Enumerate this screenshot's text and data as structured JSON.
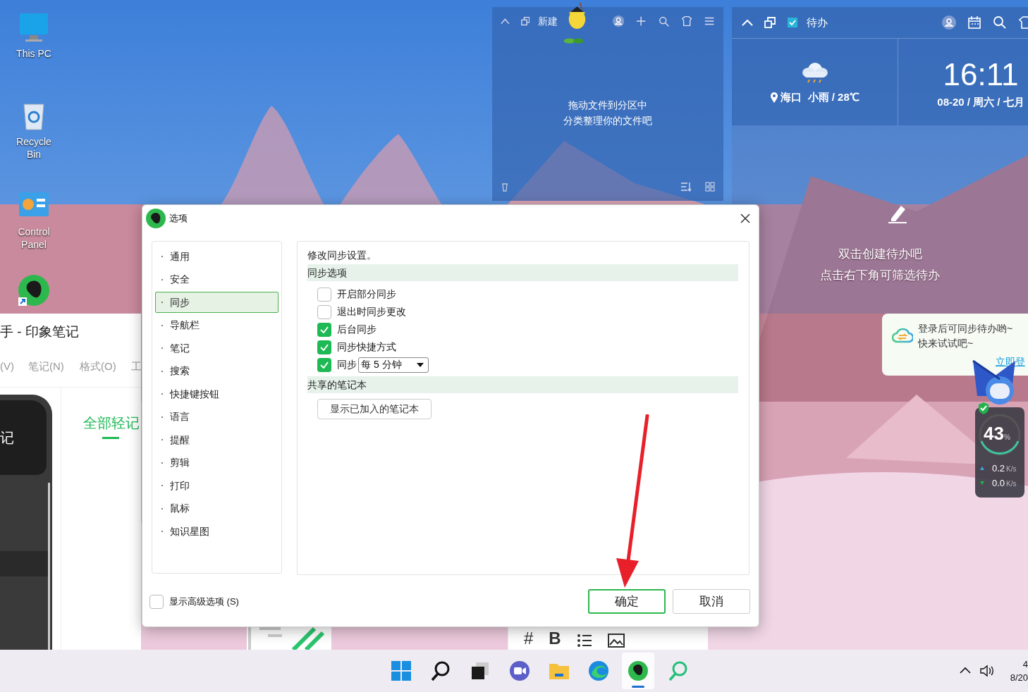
{
  "desktop_icons": [
    {
      "label": "This PC",
      "kind": "pc"
    },
    {
      "label": "Recycle Bin",
      "kind": "bin"
    },
    {
      "label": "Control Panel",
      "kind": "control"
    },
    {
      "kind": "evernote"
    }
  ],
  "files_widget": {
    "title": "新建",
    "message": [
      "拖动文件到分区中",
      "分类整理你的文件吧"
    ]
  },
  "todo_widget": {
    "title": "待办",
    "weather": "海口  小雨 / 28℃",
    "time": "16:11",
    "date": "08-20 / 周六 / 七月",
    "hint": [
      "双击创建待办吧",
      "点击右下角可筛选待办"
    ]
  },
  "login_popup": {
    "message": [
      "登录后可同步待办哟~",
      "快来试试吧~"
    ],
    "link": "立即登"
  },
  "net_monitor": {
    "percent": "43",
    "unit": "%",
    "up": "0.2",
    "up_unit": "K/s",
    "down": "0.0",
    "down_unit": "K/s"
  },
  "background_app": {
    "title": "手 - 印象笔记",
    "menu": [
      "(V)",
      "笔记(N)",
      "格式(O)",
      "工"
    ],
    "sidebar_text": "记",
    "tab": "全部轻记"
  },
  "editor_toolbar": [
    "#",
    "B"
  ],
  "dialog": {
    "title": "选项",
    "nav": [
      {
        "label": "通用",
        "selected": false
      },
      {
        "label": "安全",
        "selected": false
      },
      {
        "label": "同步",
        "selected": true
      },
      {
        "label": "导航栏",
        "selected": false
      },
      {
        "label": "笔记",
        "selected": false
      },
      {
        "label": "搜索",
        "selected": false
      },
      {
        "label": "快捷键按钮",
        "selected": false
      },
      {
        "label": "语言",
        "selected": false
      },
      {
        "label": "提醒",
        "selected": false
      },
      {
        "label": "剪辑",
        "selected": false
      },
      {
        "label": "打印",
        "selected": false
      },
      {
        "label": "鼠标",
        "selected": false
      },
      {
        "label": "知识星图",
        "selected": false
      }
    ],
    "heading": "修改同步设置。",
    "sections": [
      {
        "title": "同步选项",
        "options": [
          {
            "kind": "checkbox",
            "label": "开启部分同步",
            "checked": false
          },
          {
            "kind": "checkbox",
            "label": "退出时同步更改",
            "checked": false
          },
          {
            "kind": "checkbox",
            "label": "后台同步",
            "checked": true
          },
          {
            "kind": "checkbox",
            "label": "同步快捷方式",
            "checked": true
          },
          {
            "kind": "dropdown",
            "label": "同步",
            "checked": true,
            "value": "每 5 分钟"
          }
        ]
      },
      {
        "title": "共享的笔记本",
        "options": [
          {
            "kind": "button",
            "label": "显示已加入的笔记本"
          }
        ]
      }
    ],
    "advanced": {
      "label": "显示高级选项 (S)",
      "checked": false
    },
    "buttons": [
      {
        "label": "确定",
        "selected": true
      },
      {
        "label": "取消",
        "selected": false
      }
    ]
  },
  "taskbar": {
    "apps": [
      {
        "kind": "start",
        "selected": false
      },
      {
        "kind": "search",
        "selected": false
      },
      {
        "kind": "taskview",
        "selected": false
      },
      {
        "kind": "meet",
        "selected": false
      },
      {
        "kind": "files",
        "selected": false
      },
      {
        "kind": "edge",
        "selected": false
      },
      {
        "kind": "evernote",
        "selected": true
      },
      {
        "kind": "finder",
        "selected": false
      }
    ],
    "clock": [
      "4",
      "8/20"
    ]
  }
}
